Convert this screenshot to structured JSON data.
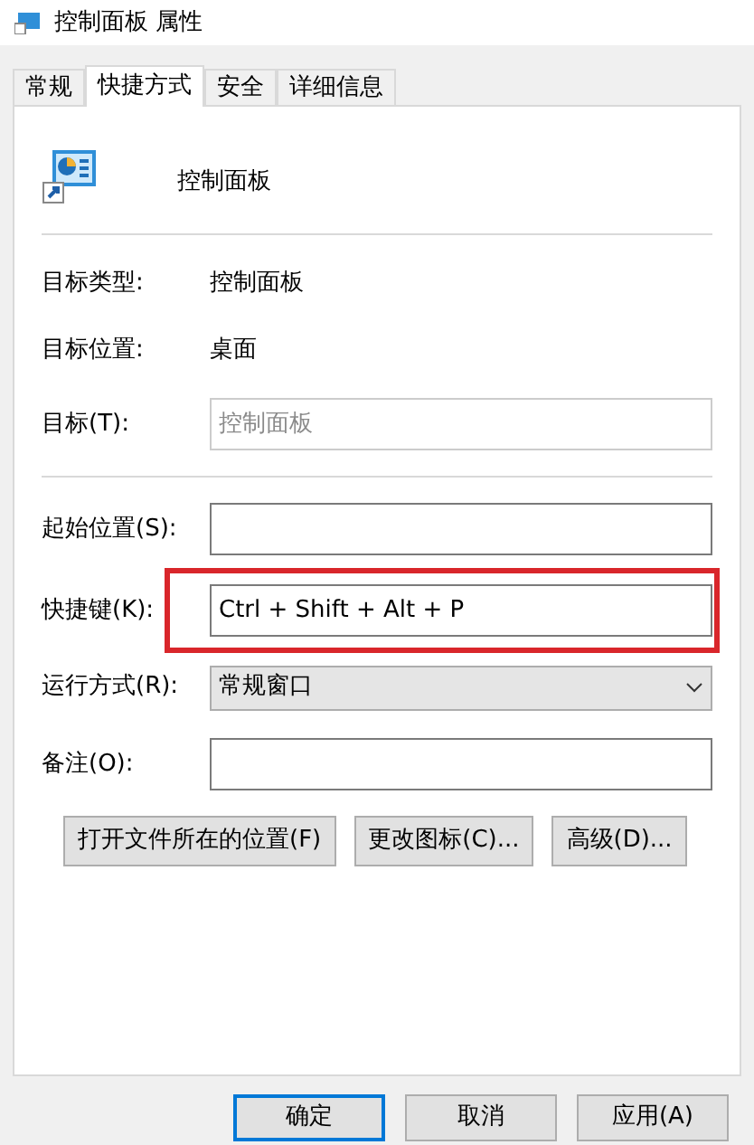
{
  "window": {
    "title": "控制面板 属性"
  },
  "tabs": [
    {
      "label": "常规",
      "selected": false
    },
    {
      "label": "快捷方式",
      "selected": true
    },
    {
      "label": "安全",
      "selected": false
    },
    {
      "label": "详细信息",
      "selected": false
    }
  ],
  "shortcut": {
    "name": "控制面板"
  },
  "rows": [
    {
      "kind": "info",
      "label": "目标类型:",
      "value": "控制面板"
    },
    {
      "kind": "info",
      "label": "目标位置:",
      "value": "桌面"
    },
    {
      "kind": "field",
      "label": "目标(T):",
      "value": "控制面板",
      "disabled": true,
      "highlighted": false
    },
    {
      "kind": "divider"
    },
    {
      "kind": "field",
      "label": "起始位置(S):",
      "disabled": false,
      "highlighted": false
    },
    {
      "kind": "field",
      "label": "快捷键(K):",
      "value": "Ctrl + Shift + Alt + P",
      "disabled": false,
      "highlighted": true
    },
    {
      "kind": "select",
      "label": "运行方式(R):",
      "value": "常规窗口"
    },
    {
      "kind": "field",
      "label": "备注(O):",
      "disabled": false,
      "highlighted": false
    }
  ],
  "action_buttons": [
    "打开文件所在的位置(F)",
    "更改图标(C)...",
    "高级(D)..."
  ],
  "dialog_buttons": [
    {
      "label": "确定",
      "default": true
    },
    {
      "label": "取消",
      "default": false
    },
    {
      "label": "应用(A)",
      "default": false
    }
  ]
}
